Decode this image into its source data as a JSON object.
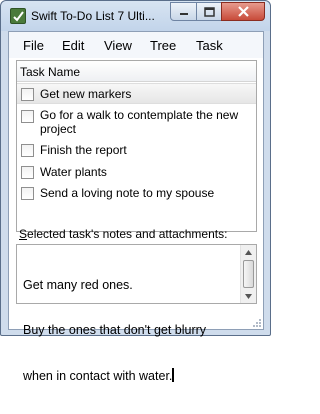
{
  "window": {
    "title": "Swift To-Do List 7 Ulti...",
    "controls": {
      "minimize": "minimize",
      "maximize": "maximize",
      "close": "close"
    }
  },
  "menu": {
    "file": "File",
    "edit": "Edit",
    "view": "View",
    "tree": "Tree",
    "task": "Task"
  },
  "tasks": {
    "column_header": "Task Name",
    "items": [
      {
        "label": "Get new markers",
        "checked": false,
        "selected": true
      },
      {
        "label_line1": "Go for a walk to contemplate the new",
        "label_line2": "project",
        "checked": false
      },
      {
        "label": "Finish the report",
        "checked": false
      },
      {
        "label": "Water plants",
        "checked": false
      },
      {
        "label": "Send a loving note to my spouse",
        "checked": false
      }
    ]
  },
  "notes": {
    "label_accel": "S",
    "label_rest": "elected task's notes and attachments:",
    "line1": "Get many red ones.",
    "line2": "Buy the ones that don't get blurry",
    "line3": "when in contact with water."
  },
  "colors": {
    "titlebar": "#c2d4ea",
    "close_button": "#c84b3a",
    "frame": "#cfdcec"
  }
}
